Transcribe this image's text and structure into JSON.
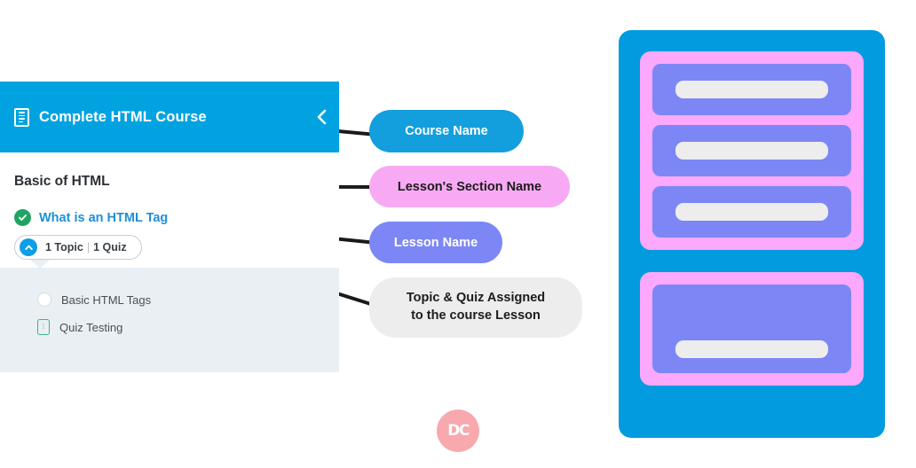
{
  "course_panel": {
    "icon": "document-list-icon",
    "title": "Complete HTML Course",
    "collapse_icon": "chevron-left-icon",
    "section_name": "Basic of HTML",
    "lesson": {
      "status_icon": "check-circle-icon",
      "name": "What is an HTML Tag",
      "meta": {
        "toggle_icon": "chevron-up-circle-icon",
        "topic_count": "1 Topic",
        "separator": "|",
        "quiz_count": "1 Quiz"
      },
      "items": [
        {
          "icon": "circle-outline-icon",
          "label": "Basic HTML Tags"
        },
        {
          "icon": "quiz-icon",
          "label": "Quiz Testing"
        }
      ]
    }
  },
  "callouts": [
    {
      "id": "course-name",
      "label": "Course Name"
    },
    {
      "id": "lessons-section-name",
      "label": "Lesson's Section Name"
    },
    {
      "id": "lesson-name",
      "label": "Lesson Name"
    },
    {
      "id": "topic-quiz-assigned",
      "line1": "Topic & Quiz Assigned",
      "line2": "to the course Lesson"
    }
  ],
  "schematic": {
    "course_color": "#029BE0",
    "section_color": "#FCA8FC",
    "lesson_color": "#7C87F5",
    "item_color": "#ededed",
    "sections": [
      {
        "lessons": [
          {
            "size": "short"
          },
          {
            "size": "short"
          },
          {
            "size": "short"
          }
        ]
      },
      {
        "lessons": [
          {
            "size": "tall"
          }
        ]
      }
    ]
  },
  "watermark": {
    "label": "DC"
  }
}
